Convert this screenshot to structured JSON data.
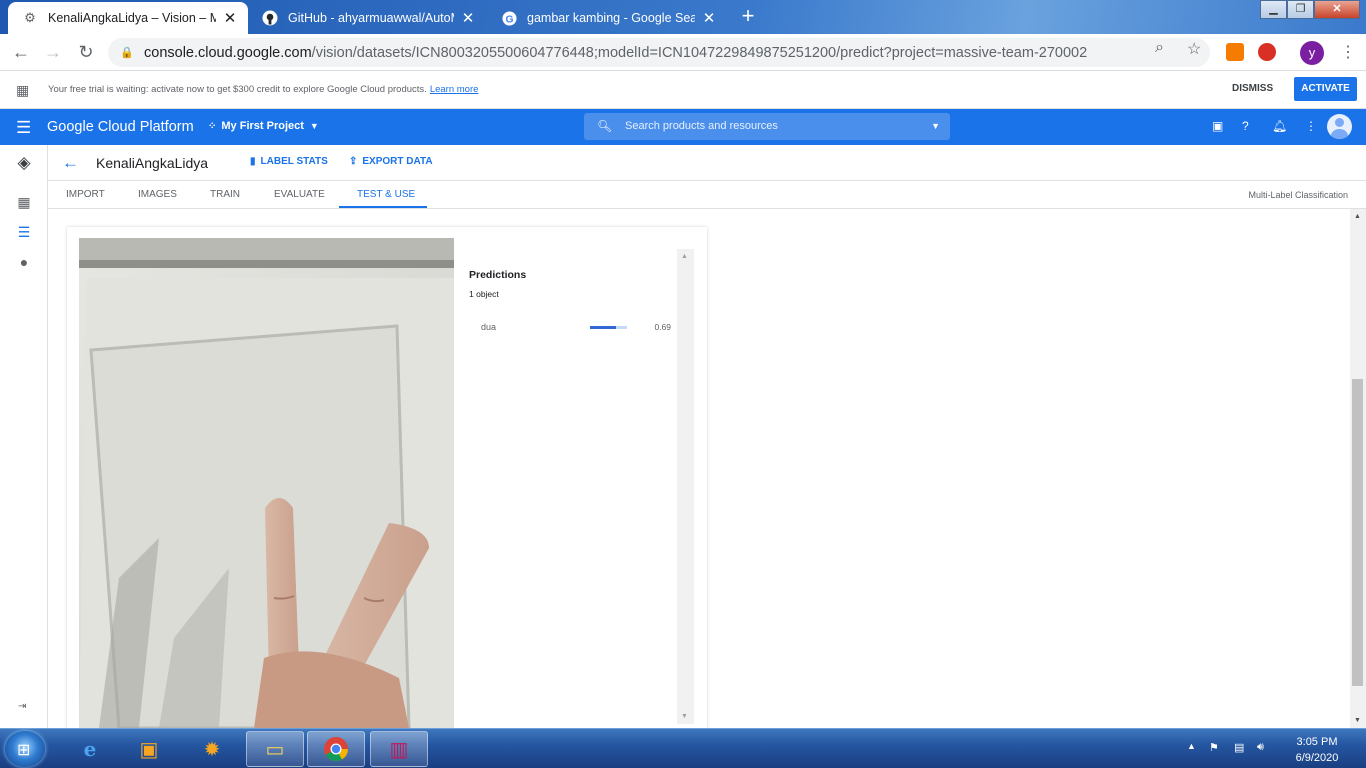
{
  "browser": {
    "tabs": [
      {
        "title": "KenaliAngkaLidya – Vision – My F",
        "favicon": "gear-icon",
        "active": true
      },
      {
        "title": "GitHub - ahyarmuawwal/AutoML",
        "favicon": "github-icon",
        "active": false
      },
      {
        "title": "gambar kambing - Google Searc",
        "favicon": "google-icon",
        "active": false
      }
    ],
    "url_host": "console.cloud.google.com",
    "url_path": "/vision/datasets/ICN8003205500604776448;modelId=ICN1047229849875251200/predict?project=massive-team-270002",
    "profile_initial": "y"
  },
  "trial_banner": {
    "message": "Your free trial is waiting: activate now to get $300 credit to explore Google Cloud products.",
    "link": "Learn more",
    "dismiss_label": "DISMISS",
    "activate_label": "ACTIVATE"
  },
  "gcp_header": {
    "title": "Google Cloud Platform",
    "project": "My First Project",
    "search_placeholder": "Search products and resources"
  },
  "page": {
    "dataset_name": "KenaliAngkaLidya",
    "label_stats": "LABEL STATS",
    "export_data": "EXPORT DATA",
    "tabs": [
      "IMPORT",
      "IMAGES",
      "TRAIN",
      "EVALUATE",
      "TEST & USE"
    ],
    "active_tab": "TEST & USE",
    "model_type": "Multi-Label Classification"
  },
  "predictions": {
    "title": "Predictions",
    "count": "1 object",
    "items": [
      {
        "label": "dua",
        "score": "0.69",
        "fraction": 0.69
      }
    ]
  },
  "taskbar": {
    "time": "3:05 PM",
    "date": "6/9/2020"
  },
  "colors": {
    "gcp_blue": "#1a73e8",
    "bar_fill": "#3367d6"
  }
}
